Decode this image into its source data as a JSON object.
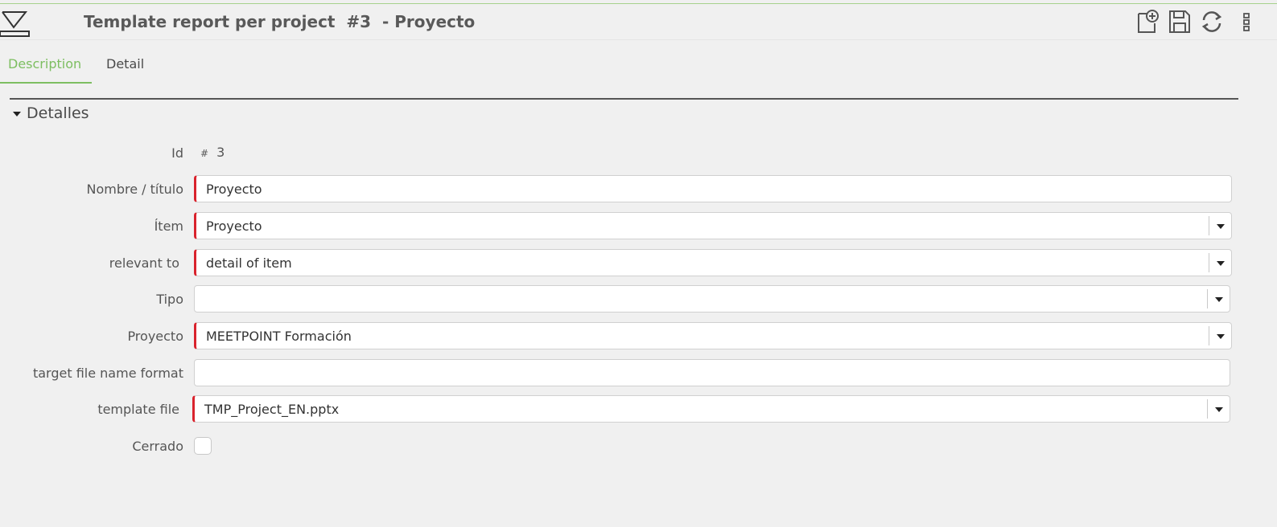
{
  "window": {
    "title": "Template report per project  #3  - Proyecto",
    "accent_color": "#7dbe61",
    "required_color": "#d9232d"
  },
  "toolbar": {
    "icons": [
      "hide-menu-icon",
      "new-document-icon",
      "save-icon",
      "refresh-icon",
      "more-options-icon"
    ]
  },
  "tabs": [
    {
      "label": "Description",
      "active": true
    },
    {
      "label": "Detail",
      "active": false
    }
  ],
  "section": {
    "title": "Detalles",
    "expanded": true
  },
  "form": {
    "id": {
      "label": "Id",
      "hash": "#",
      "value": "3"
    },
    "nombre": {
      "label": "Nombre / título",
      "value": "Proyecto",
      "required": true
    },
    "item": {
      "label": "Ítem",
      "value": "Proyecto",
      "required": true
    },
    "relevant_to": {
      "label": "relevant to",
      "value": "detail of item",
      "required": true
    },
    "tipo": {
      "label": "Tipo",
      "value": "",
      "required": false
    },
    "proyecto": {
      "label": "Proyecto",
      "value": "MEETPOINT Formación",
      "required": true
    },
    "target_file": {
      "label": "target file name format",
      "value": "",
      "required": false
    },
    "template_file": {
      "label": "template file",
      "value": "TMP_Project_EN.pptx",
      "required": true
    },
    "cerrado": {
      "label": "Cerrado",
      "checked": false
    }
  }
}
